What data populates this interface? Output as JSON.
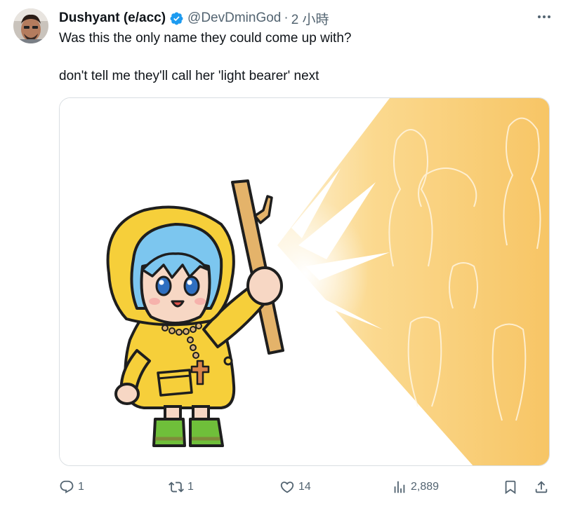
{
  "tweet": {
    "author": {
      "display_name": "Dushyant (e/acc)",
      "handle": "@DevDminGod",
      "verified": true,
      "avatar_icon": "user-avatar"
    },
    "separator": "·",
    "timestamp": "2 小時",
    "text_lines": [
      "Was this the only name they could come up with?",
      "don't tell me they'll call her 'light bearer' next"
    ],
    "media": {
      "kind": "illustration"
    },
    "actions": {
      "reply": {
        "icon": "reply-icon",
        "count": "1"
      },
      "retweet": {
        "icon": "retweet-icon",
        "count": "1"
      },
      "like": {
        "icon": "heart-icon",
        "count": "14"
      },
      "views": {
        "icon": "views-chart-icon",
        "count": "2,889"
      },
      "bookmark": {
        "icon": "bookmark-icon"
      },
      "share": {
        "icon": "share-icon"
      }
    },
    "colors": {
      "verified_badge": "#1d9bf0",
      "secondary_text": "#536471",
      "raincoat": "#f6cf3a",
      "light_beam": "#f9cf7a",
      "hair": "#7cc6ef",
      "boots": "#6fbf3a"
    }
  }
}
